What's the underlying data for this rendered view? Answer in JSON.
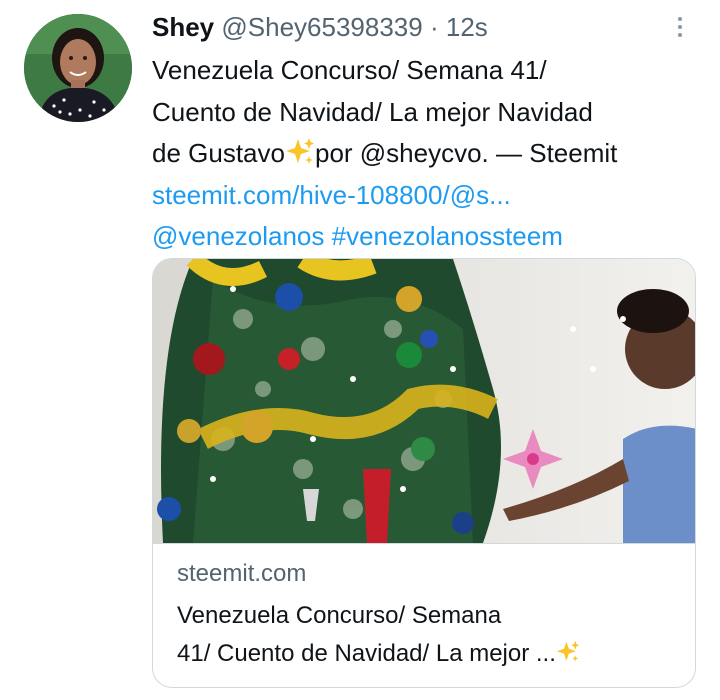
{
  "tweet": {
    "author_name": "Shey",
    "author_handle": "@Shey65398339",
    "separator": "·",
    "timestamp": "12s",
    "text_lines": [
      "Venezuela Concurso/ Semana 41/",
      "Cuento de Navidad/ La mejor Navidad",
      "de Gustavo",
      "por @sheycvo. — Steemit"
    ],
    "link_text": "steemit.com/hive-108800/@s...",
    "mention": "@venezolanos",
    "hashtag": "#venezolanossteem"
  },
  "card": {
    "domain": "steemit.com",
    "title_line1": "Venezuela Concurso/ Semana",
    "title_line2": "41/ Cuento de Navidad/ La mejor ..."
  },
  "icons": {
    "more": "more-options-icon",
    "sparkles": "sparkles-emoji-icon"
  },
  "colors": {
    "link": "#1d9bf0",
    "muted": "#536471",
    "text": "#0f1419",
    "border": "#cfd9de"
  }
}
